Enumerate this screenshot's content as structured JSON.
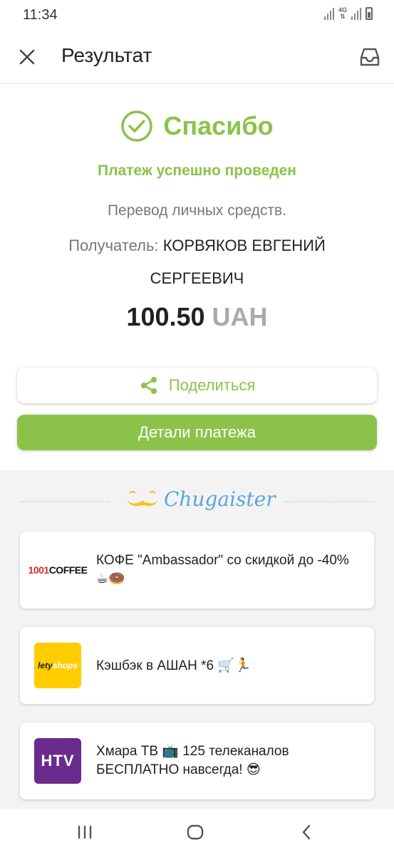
{
  "status_bar": {
    "time": "11:34",
    "network": "4G"
  },
  "header": {
    "title": "Результат"
  },
  "result": {
    "thanks": "Спасибо",
    "success_message": "Платеж успешно проведен",
    "description": "Перевод личных средств.",
    "recipient_label": "Получатель:",
    "recipient_name": "КОРВЯКОВ ЕВГЕНИЙ СЕРГЕЕВИЧ",
    "amount": "100.50",
    "currency": "UAH"
  },
  "actions": {
    "share_label": "Поделиться",
    "details_label": "Детали платежа"
  },
  "promo": {
    "brand": "Chugaister",
    "offers": [
      {
        "logo_text_a": "1001",
        "logo_text_b": "COFFEE",
        "text": "КОФЕ \"Ambassador\" со скидкой до -40% ☕🍩"
      },
      {
        "logo_text_a": "lety",
        "logo_text_b": "shops",
        "text": "Кэшбэк в АШАН *6 🛒🏃"
      },
      {
        "logo_text_a": "HTV",
        "text": "Хмара ТВ 📺 125 телеканалов БЕСПЛАТНО навсегда! 😎"
      }
    ]
  },
  "colors": {
    "accent": "#8bc34a",
    "brand_blue": "#5aa4d8",
    "lety_yellow": "#ffcc00",
    "htv_purple": "#6a2c8c"
  }
}
